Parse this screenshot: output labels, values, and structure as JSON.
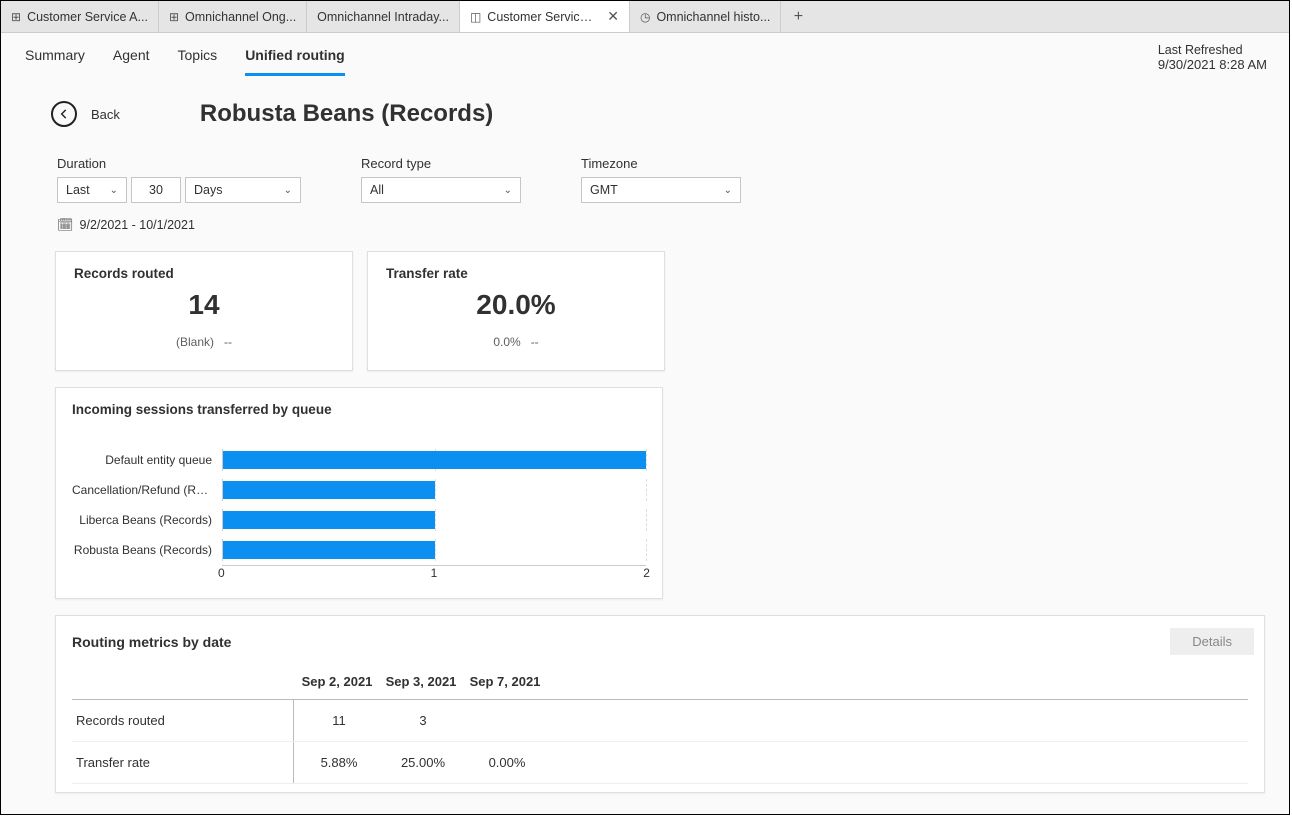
{
  "tabs": [
    {
      "label": "Customer Service A..."
    },
    {
      "label": "Omnichannel Ong..."
    },
    {
      "label": "Omnichannel Intraday..."
    },
    {
      "label": "Customer Service historic...",
      "active": true
    },
    {
      "label": "Omnichannel histo..."
    }
  ],
  "subnav": {
    "items": [
      "Summary",
      "Agent",
      "Topics",
      "Unified routing"
    ],
    "selected": "Unified routing"
  },
  "refresh": {
    "label": "Last Refreshed",
    "value": "9/30/2021 8:28 AM"
  },
  "back_label": "Back",
  "page_title": "Robusta Beans (Records)",
  "filters": {
    "duration": {
      "label": "Duration",
      "v1": "Last",
      "v2": "30",
      "v3": "Days",
      "range": "9/2/2021 - 10/1/2021"
    },
    "record_type": {
      "label": "Record type",
      "value": "All"
    },
    "timezone": {
      "label": "Timezone",
      "value": "GMT"
    }
  },
  "kpi": {
    "records_routed": {
      "title": "Records routed",
      "value": "14",
      "sub_left": "(Blank)",
      "sub_right": "--"
    },
    "transfer_rate": {
      "title": "Transfer rate",
      "value": "20.0%",
      "sub_left": "0.0%",
      "sub_right": "--"
    }
  },
  "chart_title": "Incoming sessions transferred by queue",
  "chart_data": {
    "type": "bar",
    "orientation": "horizontal",
    "categories": [
      "Default entity queue",
      "Cancellation/Refund (Rec...",
      "Liberca Beans (Records)",
      "Robusta Beans (Records)"
    ],
    "values": [
      2,
      1,
      1,
      1
    ],
    "xlim": [
      0,
      2
    ],
    "xticks": [
      0,
      1,
      2
    ],
    "title": "Incoming sessions transferred by queue"
  },
  "routing": {
    "title": "Routing metrics by date",
    "details_label": "Details",
    "dates": [
      "Sep 2, 2021",
      "Sep 3, 2021",
      "Sep 7, 2021"
    ],
    "rows": [
      {
        "label": "Records routed",
        "cells": [
          "11",
          "3",
          ""
        ]
      },
      {
        "label": "Transfer rate",
        "cells": [
          "5.88%",
          "25.00%",
          "0.00%"
        ]
      }
    ]
  }
}
